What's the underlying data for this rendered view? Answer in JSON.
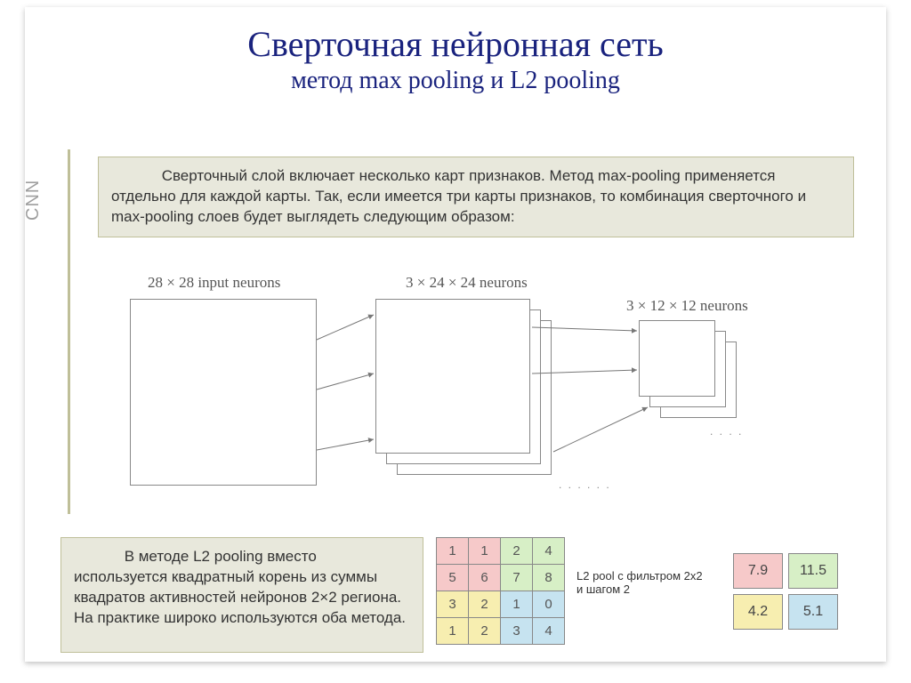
{
  "title": {
    "main": "Сверточная нейронная сеть",
    "sub": "метод max pooling и L2 pooling"
  },
  "sidebar": {
    "label": "CNN"
  },
  "paragraphs": {
    "top": "            Сверточный слой включает несколько карт признаков. Метод max-pooling применяется отдельно для каждой карты. Так, если имеется три карты признаков, то комбинация сверточного и max-pooling слоев будет выглядеть следующим образом:",
    "bottom": "            В методе L2 pooling вместо используется квадратный корень из суммы квадратов активностей нейронов 2×2 региона. На практике широко используются оба метода."
  },
  "diagram_labels": {
    "input": "28 × 28 input neurons",
    "features": "3 × 24 × 24 neurons",
    "pooled": "3 × 12 × 12 neurons"
  },
  "input_grid": [
    [
      "1",
      "1",
      "2",
      "4"
    ],
    [
      "5",
      "6",
      "7",
      "8"
    ],
    [
      "3",
      "2",
      "1",
      "0"
    ],
    [
      "1",
      "2",
      "3",
      "4"
    ]
  ],
  "mid_label": "L2 pool c фильтром 2x2 и шагом 2",
  "output_grid": [
    [
      "7.9",
      "11.5"
    ],
    [
      "4.2",
      "5.1"
    ]
  ],
  "colors": {
    "q1": "#f6c9c9",
    "q2": "#d7efc6",
    "q3": "#f7eeb0",
    "q4": "#c6e3f0"
  }
}
